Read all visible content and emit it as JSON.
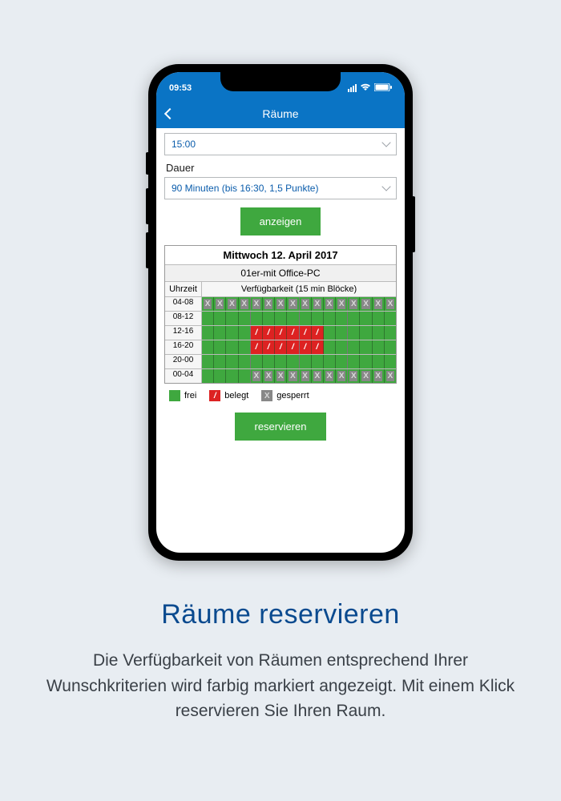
{
  "status": {
    "time": "09:53"
  },
  "nav": {
    "title": "Räume"
  },
  "form": {
    "time_value": "15:00",
    "duration_label": "Dauer",
    "duration_value": "90 Minuten (bis 16:30, 1,5 Punkte)",
    "show_button": "anzeigen",
    "reserve_button": "reservieren"
  },
  "panel": {
    "date": "Mittwoch 12. April 2017",
    "room": "01er-mit Office-PC",
    "col_time": "Uhrzeit",
    "col_avail": "Verfügbarkeit (15 min Blöcke)",
    "rows": [
      {
        "label": "04-08",
        "slots": [
          "locked",
          "locked",
          "locked",
          "locked",
          "locked",
          "locked",
          "locked",
          "locked",
          "locked",
          "locked",
          "locked",
          "locked",
          "locked",
          "locked",
          "locked",
          "locked"
        ]
      },
      {
        "label": "08-12",
        "slots": [
          "free",
          "free",
          "free",
          "free",
          "free",
          "free",
          "free",
          "free",
          "free",
          "free",
          "free",
          "free",
          "free",
          "free",
          "free",
          "free"
        ]
      },
      {
        "label": "12-16",
        "slots": [
          "free",
          "free",
          "free",
          "free",
          "busy",
          "busy",
          "busy",
          "busy",
          "busy",
          "busy",
          "free",
          "free",
          "free",
          "free",
          "free",
          "free"
        ]
      },
      {
        "label": "16-20",
        "slots": [
          "free",
          "free",
          "free",
          "free",
          "busy",
          "busy",
          "busy",
          "busy",
          "busy",
          "busy",
          "free",
          "free",
          "free",
          "free",
          "free",
          "free"
        ]
      },
      {
        "label": "20-00",
        "slots": [
          "free",
          "free",
          "free",
          "free",
          "free",
          "free",
          "free",
          "free",
          "free",
          "free",
          "free",
          "free",
          "free",
          "free",
          "free",
          "free"
        ]
      },
      {
        "label": "00-04",
        "slots": [
          "free",
          "free",
          "free",
          "free",
          "locked",
          "locked",
          "locked",
          "locked",
          "locked",
          "locked",
          "locked",
          "locked",
          "locked",
          "locked",
          "locked",
          "locked"
        ]
      }
    ]
  },
  "legend": {
    "free": "frei",
    "busy": "belegt",
    "locked": "gesperrt"
  },
  "marketing": {
    "headline": "Räume reservieren",
    "body": "Die Verfügbarkeit von Räumen ent­sprechend Ihrer Wunschkriterien wird farbig markiert angezeigt. Mit einem Klick reservieren Sie Ihren Raum."
  }
}
